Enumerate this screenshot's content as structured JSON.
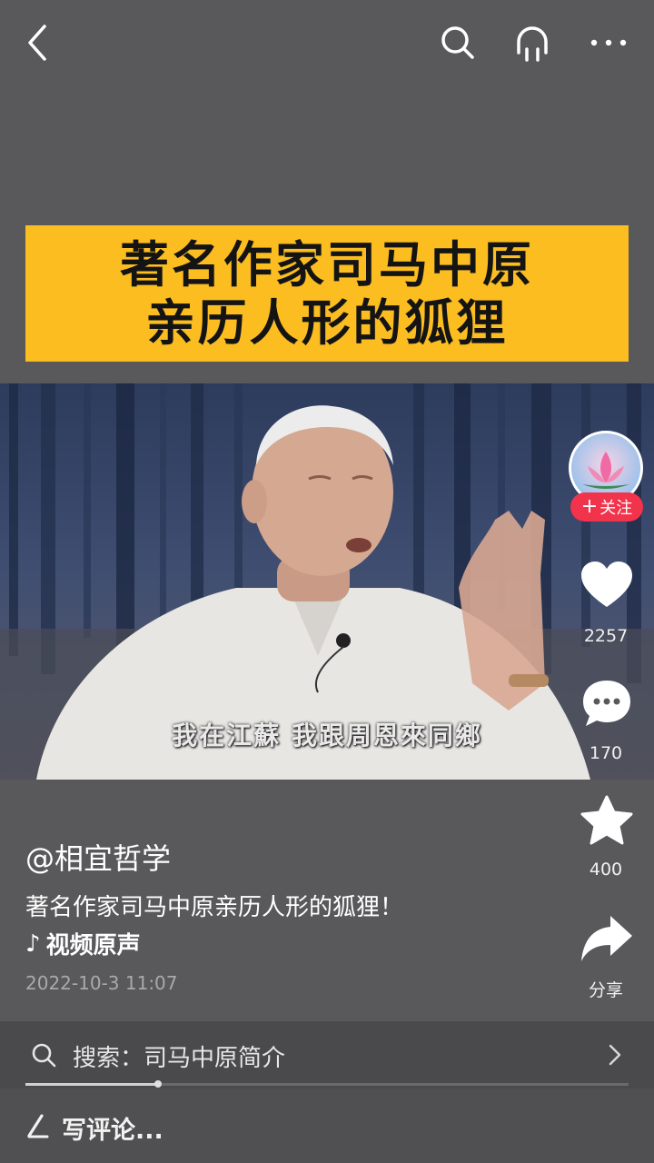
{
  "topbar": {
    "back_icon": "chevron-left-icon",
    "search_icon": "search-icon",
    "listen_icon": "headphones-icon",
    "more_icon": "more-dots-icon"
  },
  "video": {
    "banner_line1": "著名作家司马中原",
    "banner_line2": "亲历人形的狐狸",
    "subtitle": "我在江蘇  我跟周恩來同鄉",
    "banner_color": "#fbbd20"
  },
  "rail": {
    "follow_label": "关注",
    "likes": "2257",
    "comments": "170",
    "favorites": "400",
    "share_label": "分享"
  },
  "info": {
    "author": "@相宜哲学",
    "caption": "著名作家司马中原亲历人形的狐狸！",
    "music": "视频原声",
    "date": "2022-10-3 11:07"
  },
  "search": {
    "prefix": "搜索：",
    "query": "司马中原简介",
    "progress": 0.22
  },
  "comment": {
    "placeholder": "写评论..."
  }
}
